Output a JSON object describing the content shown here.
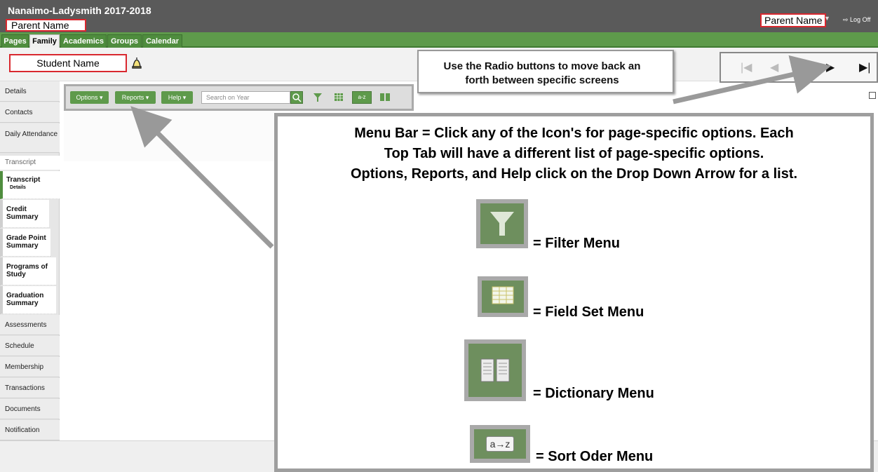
{
  "header": {
    "school_title": "Nanaimo-Ladysmith 2017-2018",
    "parent_name_top": "Parent Name",
    "user_menu": "Parent Name",
    "logoff_label": "Log Off"
  },
  "tabs": [
    {
      "label": "Pages"
    },
    {
      "label": "Family"
    },
    {
      "label": "Academics"
    },
    {
      "label": "Groups"
    },
    {
      "label": "Calendar"
    }
  ],
  "student": {
    "name": "Student Name"
  },
  "sidebar": {
    "items_top": [
      "Details",
      "Contacts",
      "Daily Attendance"
    ],
    "section_label": "Transcript",
    "sub_items": [
      {
        "label": "Transcript",
        "sublabel": "Details",
        "active": true
      },
      {
        "label": "Credit Summary",
        "active": false
      },
      {
        "label": "Grade Point Summary",
        "active": false
      },
      {
        "label": "Programs of Study",
        "active": false
      },
      {
        "label": "Graduation Summary",
        "active": false
      }
    ],
    "items_bottom": [
      "Assessments",
      "Schedule",
      "Membership",
      "Transactions",
      "Documents",
      "Notification"
    ]
  },
  "toolbar": {
    "options_label": "Options",
    "reports_label": "Reports",
    "help_label": "Help",
    "search_placeholder": "Search on Year",
    "sort_label": "a-z"
  },
  "callouts": {
    "radio_text": "Use the Radio buttons to move back an forth between specific screens",
    "menu_line1": "Menu Bar = Click any of the Icon's for page-specific options.  Each",
    "menu_line2": "Top Tab will have a different list of page-specific options.",
    "menu_line3": "Options, Reports, and Help click on the Drop Down Arrow for a list.",
    "legend": [
      {
        "icon": "filter-icon",
        "label": "= Filter Menu"
      },
      {
        "icon": "field-set-icon",
        "label": "= Field Set Menu"
      },
      {
        "icon": "dictionary-icon",
        "label": "= Dictionary Menu"
      },
      {
        "icon": "sort-order-icon",
        "label": "= Sort Oder Menu",
        "icon_text": "a→z"
      }
    ]
  },
  "colors": {
    "header_bg": "#5a5a5a",
    "tab_green": "#5e9a4b",
    "highlight_red": "#d9282f"
  }
}
